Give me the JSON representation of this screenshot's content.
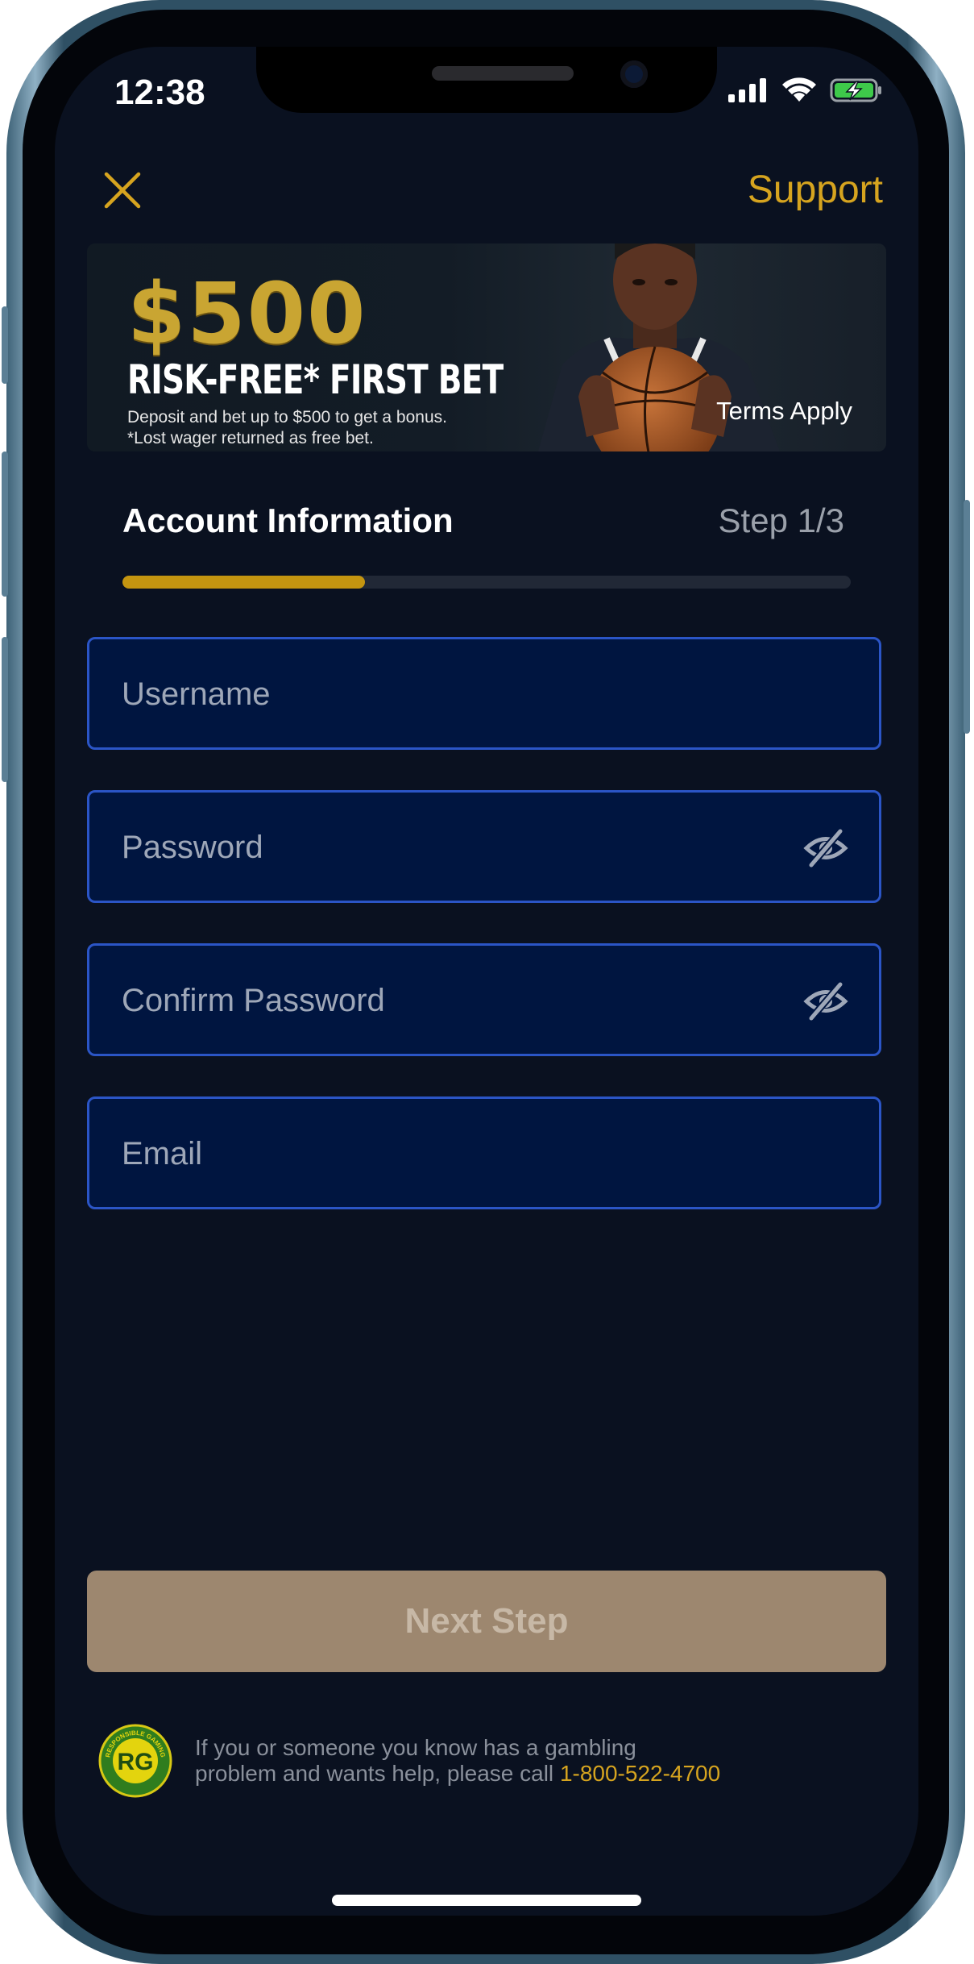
{
  "status_bar": {
    "time": "12:38"
  },
  "header": {
    "support_label": "Support"
  },
  "banner": {
    "amount": "$500",
    "headline": "RISK-FREE* FIRST BET",
    "line1": "Deposit and bet up to $500 to get a bonus.",
    "line2": "*Lost wager returned as free bet.",
    "terms": "Terms Apply"
  },
  "section": {
    "title": "Account Information",
    "step": "Step 1/3",
    "progress_fraction": 0.333
  },
  "form": {
    "username": {
      "placeholder": "Username",
      "value": ""
    },
    "password": {
      "placeholder": "Password",
      "value": ""
    },
    "confirm_password": {
      "placeholder": "Confirm Password",
      "value": ""
    },
    "email": {
      "placeholder": "Email",
      "value": ""
    }
  },
  "next_button": {
    "label": "Next Step"
  },
  "footer": {
    "logo_text": "RG",
    "logo_ring_text": "RESPONSIBLE GAMING",
    "help_line1": "If you or someone you know has a gambling",
    "help_line2": "problem and wants help, please call ",
    "phone": "1-800-522-4700"
  },
  "colors": {
    "accent": "#d6a41f",
    "background": "#0a1120",
    "field_bg": "#001540",
    "field_border": "#2b55c6",
    "button_disabled": "#9d876f"
  }
}
